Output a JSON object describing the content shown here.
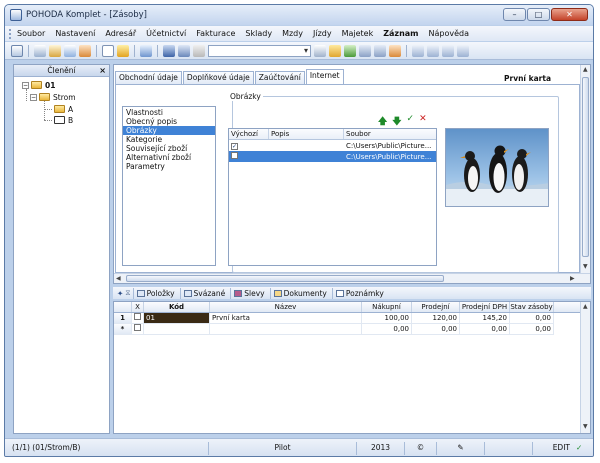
{
  "window": {
    "title": "POHODA Komplet - [Zásoby]",
    "minimize": "–",
    "maximize": "□",
    "close": "✕"
  },
  "menu": [
    "Soubor",
    "Nastavení",
    "Adresář",
    "Účetnictví",
    "Fakturace",
    "Sklady",
    "Mzdy",
    "Jízdy",
    "Majetek",
    "Záznam",
    "Nápověda"
  ],
  "left_pane": {
    "title": "Členění",
    "close": "×",
    "tree": {
      "root": "01",
      "level1": "Strom",
      "items": [
        "A",
        "B"
      ]
    }
  },
  "tabs": [
    "Obchodní údaje",
    "Doplňkové údaje",
    "Zaúčtování",
    "Internet"
  ],
  "card_title": "První karta",
  "group_title": "Obrázky",
  "sections": [
    "Vlastnosti",
    "Obecný popis",
    "Obrázky",
    "Kategorie",
    "Související zboží",
    "Alternativní zboží",
    "Parametry"
  ],
  "image_table": {
    "headers": [
      "Výchozí",
      "Popis",
      "Soubor"
    ],
    "rows": [
      {
        "default": "✓",
        "desc": "",
        "file": "C:\\Users\\Public\\Picture..."
      },
      {
        "default": "",
        "desc": "",
        "file": "C:\\Users\\Public\\Picture..."
      }
    ]
  },
  "image_tools": {
    "up": "🡅",
    "down": "🡇",
    "ok": "✓",
    "remove": "✕"
  },
  "subtabs": [
    "Položky",
    "Svázané",
    "Slevy",
    "Dokumenty",
    "Poznámky"
  ],
  "grid": {
    "headers": [
      "X",
      "Kód",
      "Název",
      "Nákupní",
      "Prodejní",
      "Prodejní DPH",
      "Stav zásoby"
    ],
    "rows": [
      {
        "n": "1",
        "kod": "01",
        "nazev": "První karta",
        "nakupni": "100,00",
        "prodejni": "120,00",
        "dph": "145,20",
        "stav": "0,00"
      },
      {
        "n": "*",
        "kod": "",
        "nazev": "",
        "nakupni": "0,00",
        "prodejni": "0,00",
        "dph": "0,00",
        "stav": "0,00"
      }
    ]
  },
  "status": {
    "records": "(1/1) (01/Strom/B)",
    "company": "Pilot",
    "year": "2013",
    "copy": "©",
    "mode": "EDIT"
  }
}
